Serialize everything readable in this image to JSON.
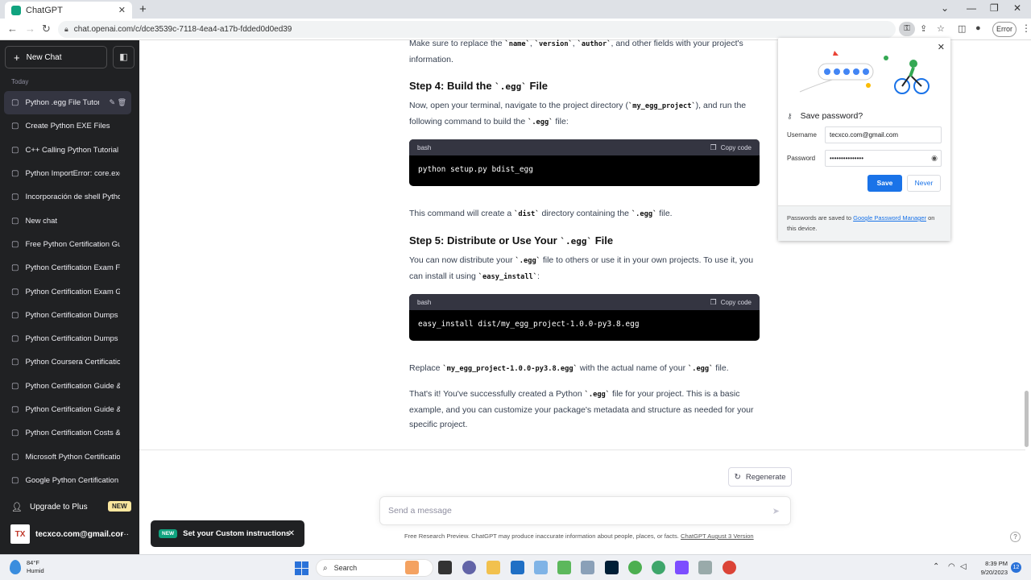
{
  "browser": {
    "tab_title": "ChatGPT",
    "tab_close": "✕",
    "new_tab": "+",
    "url": "chat.openai.com/c/dce3539c-7118-4ea4-a17b-fdded0d0ed39",
    "error_label": "Error"
  },
  "sidebar": {
    "new_chat": "New Chat",
    "section_label": "Today",
    "items": [
      {
        "label": "Python .egg File Tutori"
      },
      {
        "label": "Create Python EXE Files"
      },
      {
        "label": "C++ Calling Python Tutorial"
      },
      {
        "label": "Python ImportError: core.exc"
      },
      {
        "label": "Incorporación de shell Pytho"
      },
      {
        "label": "New chat"
      },
      {
        "label": "Free Python Certification Gu"
      },
      {
        "label": "Python Certification Exam Fe"
      },
      {
        "label": "Python Certification Exam Gu"
      },
      {
        "label": "Python Certification Dumps T"
      },
      {
        "label": "Python Certification Dumps"
      },
      {
        "label": "Python Coursera Certification"
      },
      {
        "label": "Python Certification Guide &"
      },
      {
        "label": "Python Certification Guide &"
      },
      {
        "label": "Python Certification Costs &"
      },
      {
        "label": "Microsoft Python Certificatio"
      },
      {
        "label": "Google Python Certification"
      }
    ],
    "upgrade": "Upgrade to Plus",
    "upgrade_badge": "NEW",
    "avatar_text": "TX",
    "user_email": "tecxco.com@gmail.cor"
  },
  "main": {
    "p1a": "Make sure to replace the ",
    "p1_code1": "`name`",
    "p1_sep1": ", ",
    "p1_code2": "`version`",
    "p1_sep2": ", ",
    "p1_code3": "`author`",
    "p1b": ", and other fields with your project's information.",
    "h_step4_a": "Step 4: Build the ",
    "h_step4_code": "`.egg`",
    "h_step4_b": " File",
    "p2a": "Now, open your terminal, navigate to the project directory (",
    "p2_code1": "`my_egg_project`",
    "p2b": "), and run the following command to build the ",
    "p2_code2": "`.egg`",
    "p2c": " file:",
    "code1_lang": "bash",
    "code1_copy": "Copy code",
    "code1_body": "python setup.py bdist_egg",
    "p3a": "This command will create a ",
    "p3_code1": "`dist`",
    "p3b": " directory containing the ",
    "p3_code2": "`.egg`",
    "p3c": " file.",
    "h_step5_a": "Step 5: Distribute or Use Your ",
    "h_step5_code": "`.egg`",
    "h_step5_b": " File",
    "p4a": "You can now distribute your ",
    "p4_code1": "`.egg`",
    "p4b": " file to others or use it in your own projects. To use it, you can install it using ",
    "p4_code2": "`easy_install`",
    "p4c": ":",
    "code2_lang": "bash",
    "code2_copy": "Copy code",
    "code2_body": "easy_install dist/my_egg_project-1.0.0-py3.8.egg",
    "p5a": "Replace ",
    "p5_code1": "`my_egg_project-1.0.0-py3.8.egg`",
    "p5b": " with the actual name of your ",
    "p5_code2": "`.egg`",
    "p5c": " file.",
    "p6a": "That's it! You've successfully created a Python ",
    "p6_code1": "`.egg`",
    "p6b": " file for your project. This is a basic example, and you can customize your package's metadata and structure as needed for your specific project.",
    "regenerate": "Regenerate",
    "input_placeholder": "Send a message",
    "footnote": "Free Research Preview. ChatGPT may produce inaccurate information about people, places, or facts. ",
    "footnote_link": "ChatGPT August 3 Version",
    "help": "?"
  },
  "toast": {
    "badge": "NEW",
    "text": "Set your Custom instructions",
    "close": "✕"
  },
  "password_popup": {
    "title": "Save password?",
    "username_label": "Username",
    "username_value": "tecxco.com@gmail.com",
    "password_label": "Password",
    "password_value": "•••••••••••••••",
    "save": "Save",
    "never": "Never",
    "footer_a": "Passwords are saved to ",
    "footer_link": "Google Password Manager",
    "footer_b": " on this device."
  },
  "taskbar": {
    "temp": "84°F",
    "condition": "Humid",
    "search": "Search",
    "time": "8:39 PM",
    "date": "9/20/2023",
    "notif_count": "12"
  },
  "colors": {
    "sidebar_bg": "#202123",
    "accent_green": "#10a37f",
    "chrome_blue": "#1a73e8"
  }
}
